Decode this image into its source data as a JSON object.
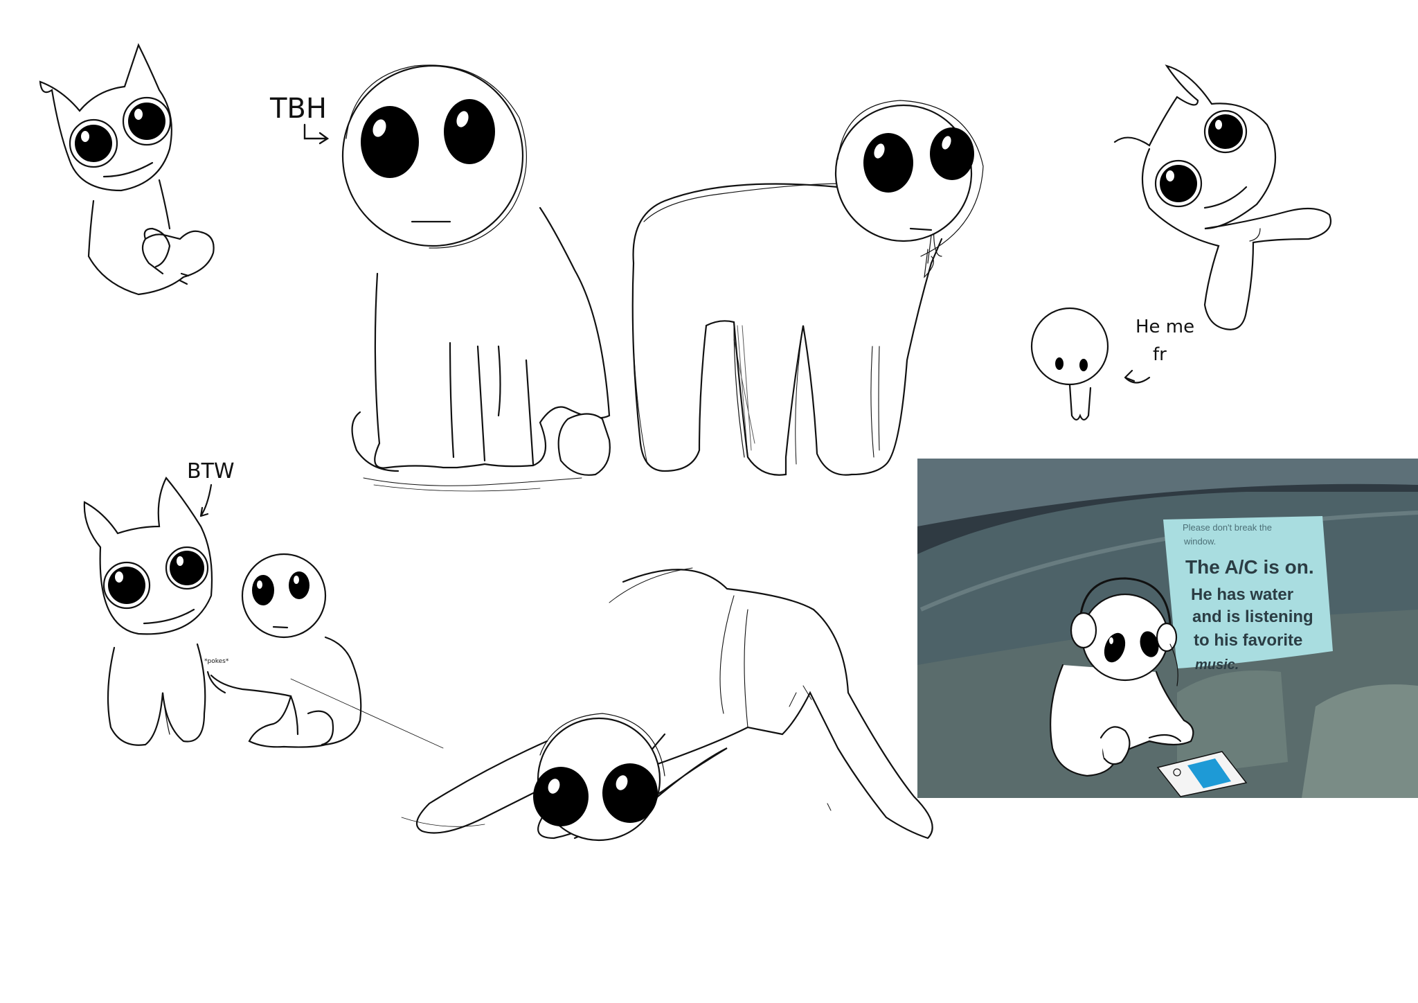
{
  "annotations": {
    "tbh": "TBH",
    "btw": "BTW",
    "he_me": "He me",
    "fr": "fr",
    "tiny_text": "*pokes*"
  },
  "photo": {
    "sign_line1": "Please don't break the",
    "sign_line2": "window.",
    "sign_line3": "The A/C is on.",
    "sign_line4": "He has water",
    "sign_line5": "and is listening",
    "sign_line6": "to his favorite",
    "sign_line7": "music."
  },
  "colors": {
    "ink": "#111111",
    "paper": "#ffffff",
    "sign": "#a9dde0",
    "car_dark": "#2f3a42",
    "glass": "#4d6268",
    "screen": "#1e9ad6"
  }
}
